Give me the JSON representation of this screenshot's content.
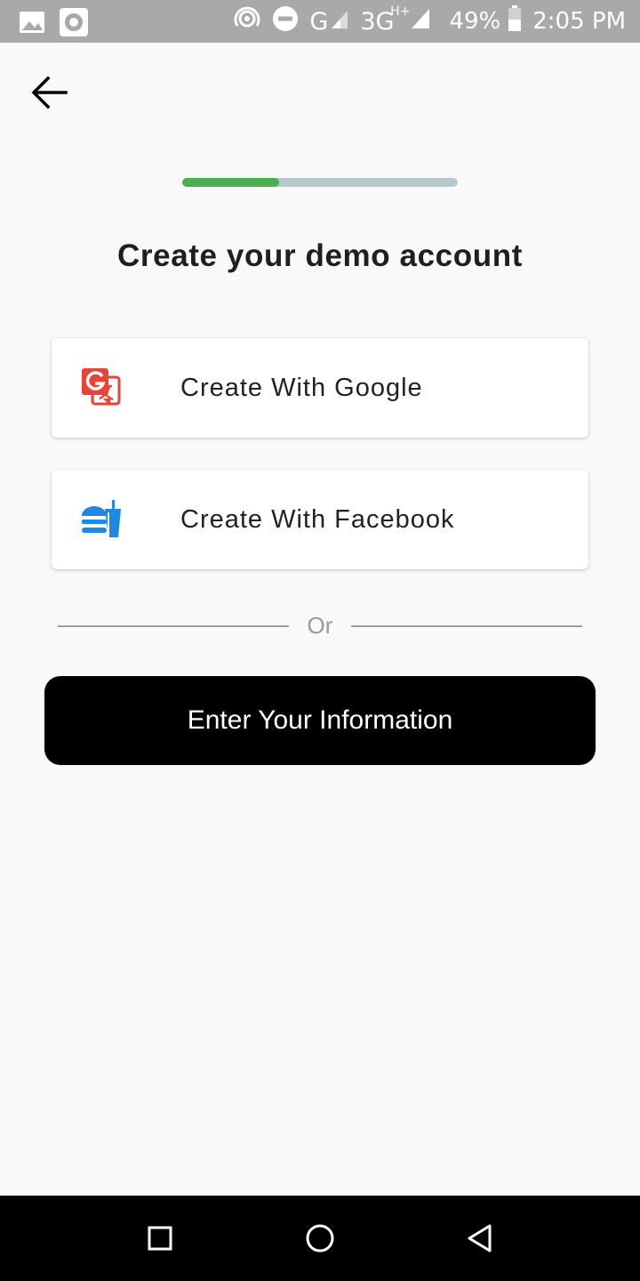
{
  "status_bar": {
    "icons_left": [
      "image-icon",
      "radio-icon"
    ],
    "icons_right": [
      "hotspot-icon",
      "dnd-icon",
      "signal-icon"
    ],
    "network_g": "G",
    "network_3g": "3G",
    "network_sup": "H+",
    "battery": "49%",
    "time": "2:05 PM"
  },
  "header": {
    "back_icon": "arrow-left-icon"
  },
  "progress": {
    "value": 0.35,
    "fill_color": "#4caf50",
    "track_color": "#b8c8cf"
  },
  "main": {
    "title": "Create your demo account",
    "google_button": {
      "label": "Create With Google",
      "icon": "google-translate-icon",
      "icon_color": "#ea4335"
    },
    "facebook_button": {
      "label": "Create With Facebook",
      "icon": "fastfood-icon",
      "icon_color": "#1e88e5"
    },
    "divider_text": "Or",
    "primary_button": {
      "label": "Enter Your Information"
    }
  },
  "nav_bar": {
    "items": [
      "recent-apps-icon",
      "home-icon",
      "back-triangle-icon"
    ]
  }
}
